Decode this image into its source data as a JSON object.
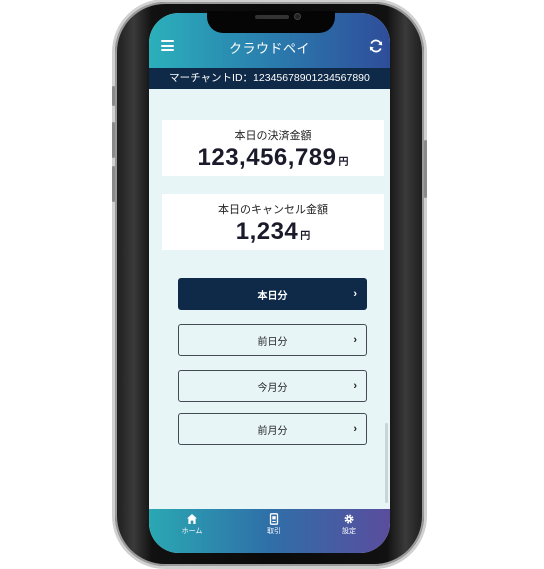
{
  "header": {
    "title": "クラウドペイ",
    "menu_icon": "hamburger-menu-icon",
    "refresh_icon": "refresh-icon"
  },
  "merchant": {
    "text": "マーチャントID：12345678901234567890"
  },
  "today_payment": {
    "label": "本日の決済金額",
    "amount": "123,456,789",
    "unit": "円"
  },
  "today_cancel": {
    "label": "本日のキャンセル金額",
    "amount": "1,234",
    "unit": "円"
  },
  "period_buttons": [
    {
      "label": "本日分",
      "active": true
    },
    {
      "label": "前日分",
      "active": false
    },
    {
      "label": "今月分",
      "active": false
    },
    {
      "label": "前月分",
      "active": false
    }
  ],
  "chevron": "›",
  "tabbar": [
    {
      "label": "ホーム",
      "icon": "home-icon"
    },
    {
      "label": "取引",
      "icon": "receipt-icon"
    },
    {
      "label": "設定",
      "icon": "gear-icon"
    }
  ],
  "colors": {
    "header_gradient_start": "#2bb0bb",
    "header_gradient_end": "#2f4d9a",
    "navy": "#0f2a48",
    "screen_bg": "#e8f5f7"
  }
}
